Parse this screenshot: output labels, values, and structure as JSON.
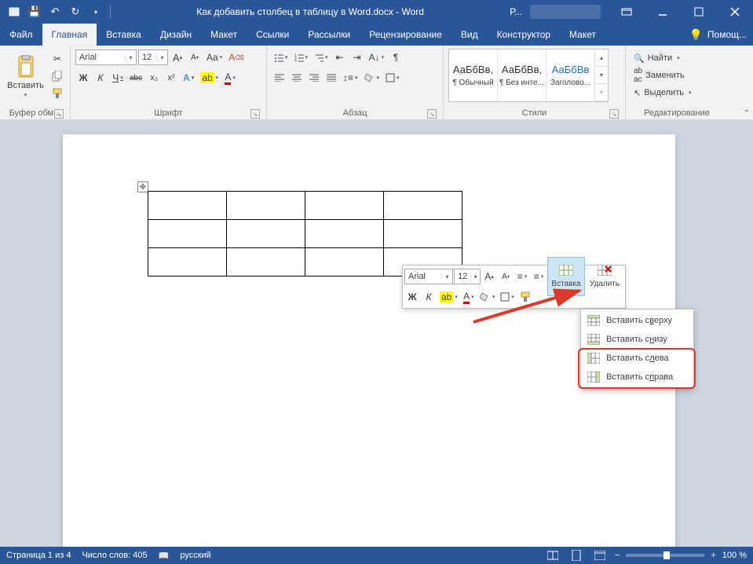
{
  "title": "Как добавить столбец в таблицу в Word.docx  -  Word",
  "qat_ribbon_label": "Р...",
  "tabs": [
    "Файл",
    "Главная",
    "Вставка",
    "Дизайн",
    "Макет",
    "Ссылки",
    "Рассылки",
    "Рецензирование",
    "Вид",
    "Конструктор",
    "Макет"
  ],
  "help": "Помощ...",
  "clipboard": {
    "paste": "Вставить",
    "group": "Буфер обм..."
  },
  "font": {
    "name": "Arial",
    "size": "12",
    "group": "Шрифт",
    "bold": "Ж",
    "italic": "К",
    "underline": "Ч",
    "strike": "abc",
    "sub": "x₂",
    "sup": "x²",
    "caps": "Aa",
    "clear": "A",
    "grow": "A",
    "shrink": "A"
  },
  "paragraph": {
    "group": "Абзац"
  },
  "styles": {
    "group": "Стили",
    "items": [
      {
        "preview": "АаБбВв,",
        "name": "¶ Обычный"
      },
      {
        "preview": "АаБбВв,",
        "name": "¶ Без инте..."
      },
      {
        "preview": "АаБбВв",
        "name": "Заголово..."
      }
    ]
  },
  "editing": {
    "group": "Редактирование",
    "find": "Найти",
    "replace": "Заменить",
    "select": "Выделить"
  },
  "mini": {
    "font": "Arial",
    "size": "12",
    "bold": "Ж",
    "italic": "К",
    "insert": "Вставка",
    "delete": "Удалить"
  },
  "menu": {
    "above": "Вставить сверху",
    "below": "Вставить снизу",
    "left": "Вставить слева",
    "right": "Вставить справа"
  },
  "status": {
    "page": "Страница 1 из 4",
    "words": "Число слов: 405",
    "lang": "русский",
    "zoom": "100 %"
  }
}
